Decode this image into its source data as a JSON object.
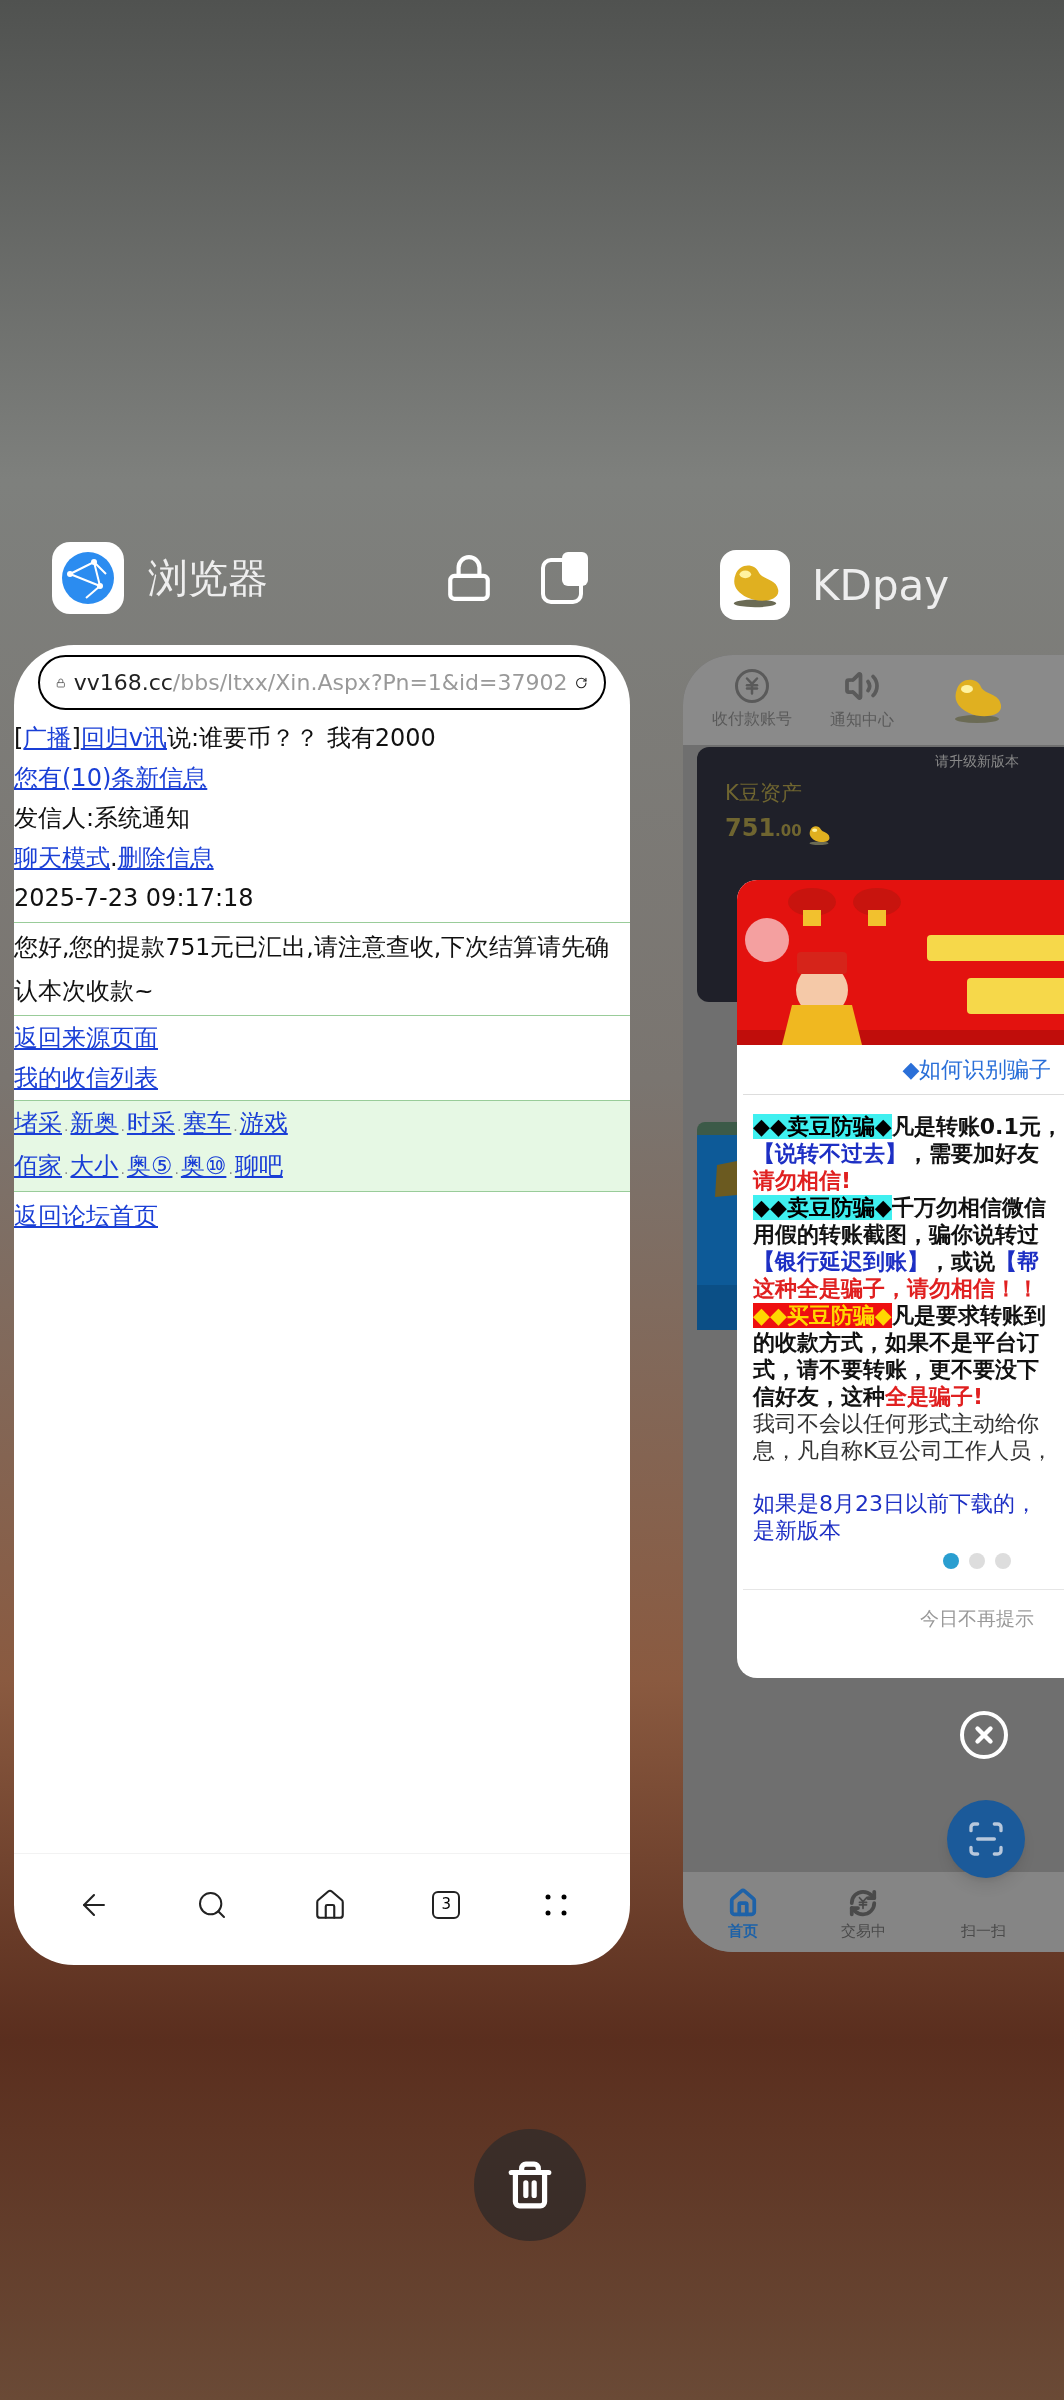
{
  "browser_card": {
    "app_name": "浏览器",
    "address_bar": {
      "host": "vv168.cc",
      "path": "/bbs/ltxx/Xin.Aspx?Pn=1&id=37902"
    },
    "page": {
      "broadcast": [
        {
          "kind": "text",
          "text": "["
        },
        {
          "kind": "link",
          "text": "广播"
        },
        {
          "kind": "text",
          "text": "]"
        },
        {
          "kind": "link",
          "text": "回归v讯"
        },
        {
          "kind": "text",
          "text": "说:谁要币？？ 我有2000"
        }
      ],
      "new_messages_link": "您有(10)条新信息",
      "sender": "发信人:系统通知",
      "actions": [
        "聊天模式",
        "删除信息"
      ],
      "separator": ".",
      "timestamp": "2025-7-23 09:17:18",
      "message": "您好,您的提款751元已汇出,请注意查收,下次结算请先确认本次收款~",
      "links": [
        "返回来源页面",
        "我的收信列表"
      ],
      "game_links": [
        [
          "堵采",
          "新奥",
          "时采",
          "塞车",
          "游戏"
        ],
        [
          "佰家",
          "大小",
          "奥⑤",
          "奥⑩",
          "聊吧"
        ]
      ],
      "forum_home_link": "返回论坛首页"
    },
    "tab_count": "3"
  },
  "kdpay_card": {
    "app_name": "KDpay",
    "top_tabs": [
      {
        "label": "收付款账号",
        "kind": "coin"
      },
      {
        "label": "通知中心",
        "kind": "speaker"
      }
    ],
    "upgrade_notice": "请升级新版本",
    "asset_label": "K豆资产",
    "asset_value": "751",
    "asset_decimals": ".00",
    "popup": {
      "title": "◆如何识别骗子",
      "paragraphs": [
        {
          "kind": "bold",
          "lines": [
            [
              {
                "kind": "tag_cyan",
                "text": "◆◆卖豆防骗◆"
              },
              {
                "kind": "plain",
                "text": "凡是转账0.1元，"
              }
            ],
            [
              {
                "kind": "blue",
                "text": "【说转不过去】"
              },
              {
                "kind": "plain",
                "text": "，需要加好友"
              }
            ],
            [
              {
                "kind": "red",
                "text": "请勿相信!"
              }
            ]
          ]
        },
        {
          "kind": "bold",
          "lines": [
            [
              {
                "kind": "tag_cyan",
                "text": "◆◆卖豆防骗◆"
              },
              {
                "kind": "plain",
                "text": "千万勿相信微信"
              }
            ],
            [
              {
                "kind": "plain",
                "text": "用假的转账截图，骗你说转过"
              }
            ],
            [
              {
                "kind": "blue",
                "text": "【银行延迟到账】"
              },
              {
                "kind": "plain",
                "text": "，或说"
              },
              {
                "kind": "blue",
                "text": "【帮"
              }
            ],
            [
              {
                "kind": "red",
                "text": "这种全是骗子，请勿相信！！"
              }
            ]
          ]
        },
        {
          "kind": "bold",
          "lines": [
            [
              {
                "kind": "tag_red",
                "text": "◆◆买豆防骗◆"
              },
              {
                "kind": "plain",
                "text": "凡是要求转账到"
              }
            ],
            [
              {
                "kind": "plain",
                "text": "的收款方式，如果不是平台订"
              }
            ],
            [
              {
                "kind": "plain",
                "text": "式，请不要转账，更不要没下"
              }
            ],
            [
              {
                "kind": "plain",
                "text": "信好友，这种"
              },
              {
                "kind": "red",
                "text": "全是骗子!"
              }
            ]
          ]
        },
        {
          "kind": "normal",
          "lines": [
            [
              {
                "kind": "plain",
                "text": "我司不会以任何形式主动给你"
              }
            ],
            [
              {
                "kind": "plain",
                "text": "息，凡自称K豆公司工作人员，"
              }
            ]
          ]
        },
        {
          "kind": "notice",
          "lines": [
            [
              {
                "kind": "blue",
                "text": "如果是8月23日以前下载的，"
              }
            ],
            [
              {
                "kind": "blue",
                "text": "是新版本"
              }
            ]
          ]
        }
      ],
      "pages": [
        {
          "selected": true
        },
        {
          "selected": false
        },
        {
          "selected": false
        }
      ],
      "dismiss": "今日不再提示"
    },
    "bottom_nav": [
      {
        "label": "首页",
        "kind": "home",
        "selected": true
      },
      {
        "label": "交易中",
        "kind": "exchange",
        "selected": false
      },
      {
        "label": "扫一扫",
        "kind": "scan",
        "selected": false
      }
    ]
  }
}
